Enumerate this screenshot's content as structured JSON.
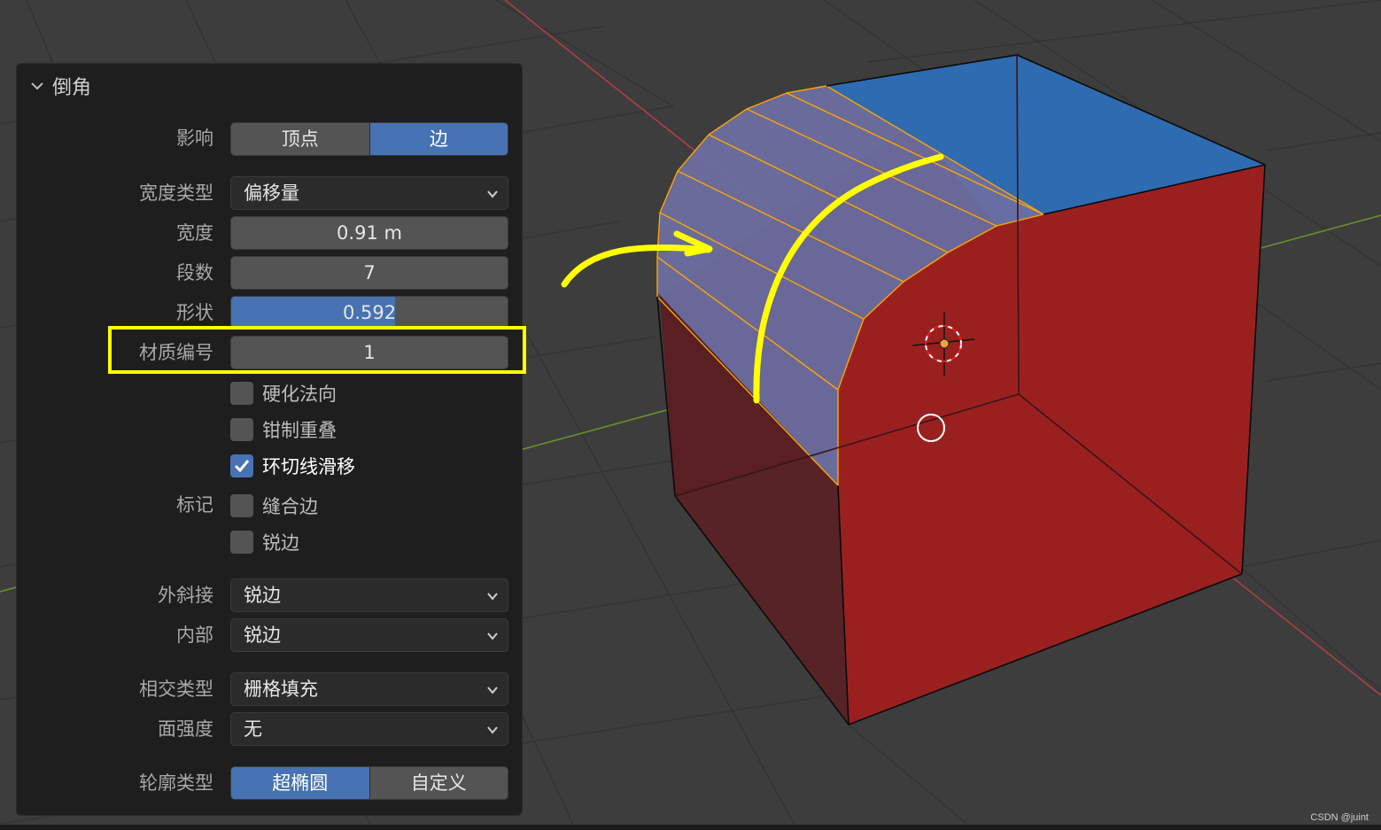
{
  "panel": {
    "title": "倒角",
    "affect": {
      "label": "影响",
      "options": [
        "顶点",
        "边"
      ],
      "selected": "边"
    },
    "width_type": {
      "label": "宽度类型",
      "value": "偏移量"
    },
    "width": {
      "label": "宽度",
      "value": "0.91 m"
    },
    "segments": {
      "label": "段数",
      "value": "7"
    },
    "shape": {
      "label": "形状",
      "value": "0.592",
      "fraction": 0.592
    },
    "material": {
      "label": "材质编号",
      "value": "1"
    },
    "harden_normals": {
      "label": "硬化法向",
      "checked": false
    },
    "clamp_overlap": {
      "label": "钳制重叠",
      "checked": false
    },
    "loop_slide": {
      "label": "环切线滑移",
      "checked": true
    },
    "mark": {
      "label": "标记"
    },
    "mark_seam": {
      "label": "缝合边",
      "checked": false
    },
    "mark_sharp": {
      "label": "锐边",
      "checked": false
    },
    "miter_outer": {
      "label": "外斜接",
      "value": "锐边"
    },
    "miter_inner": {
      "label": "内部",
      "value": "锐边"
    },
    "intersection_type": {
      "label": "相交类型",
      "value": "栅格填充"
    },
    "face_strength": {
      "label": "面强度",
      "value": "无"
    },
    "profile_type": {
      "label": "轮廓类型",
      "options": [
        "超椭圆",
        "自定义"
      ],
      "selected": "超椭圆"
    }
  },
  "watermark": "CSDN @juint",
  "colors": {
    "viewport_bg": "#3d3d3d",
    "panel_bg": "#1e1e1e",
    "accent": "#4772b3",
    "annotation": "#ffff00",
    "red_face": "#9a2020",
    "blue_face": "#2e6bb0",
    "selected_edge": "#ffa500"
  }
}
